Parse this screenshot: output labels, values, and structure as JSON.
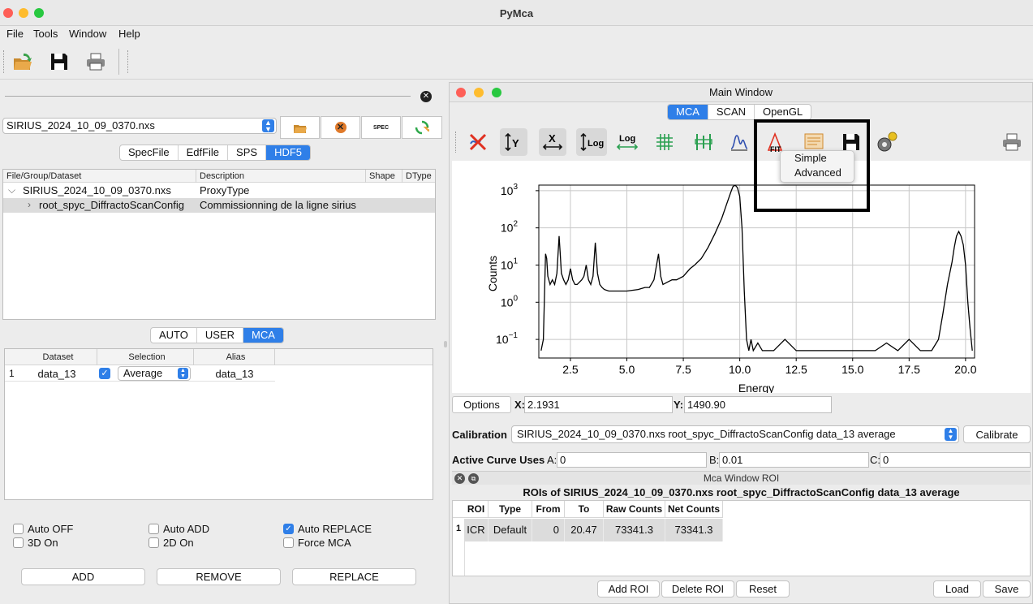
{
  "app": {
    "title": "PyMca"
  },
  "colors": {
    "accent": "#2f7fe8",
    "close": "#fe5f57",
    "minimize": "#febc2e",
    "maximize": "#28c840"
  },
  "menu": [
    "File",
    "Tools",
    "Window",
    "Help"
  ],
  "toolbar_icons": [
    "open-icon",
    "save-icon",
    "print-icon"
  ],
  "left": {
    "file_select": "SIRIUS_2024_10_09_0370.nxs",
    "source_tabs": [
      "SpecFile",
      "EdfFile",
      "SPS",
      "HDF5"
    ],
    "source_active": "HDF5",
    "tree_headers": [
      "File/Group/Dataset",
      "Description",
      "Shape",
      "DType"
    ],
    "tree_rows": [
      {
        "name": "SIRIUS_2024_10_09_0370.nxs",
        "desc": "ProxyType",
        "indent": 0,
        "arrow": "⌵"
      },
      {
        "name": "root_spyc_DiffractoScanConfig",
        "desc": "Commissionning de la ligne sirius",
        "indent": 1,
        "arrow": "›"
      }
    ],
    "mode_tabs": [
      "AUTO",
      "USER",
      "MCA"
    ],
    "mode_active": "MCA",
    "sel_headers": [
      "Dataset",
      "Selection",
      "Alias"
    ],
    "sel_row": {
      "num": "1",
      "dataset": "data_13",
      "selection": "Average",
      "alias": "data_13"
    },
    "options": [
      {
        "label": "Auto OFF",
        "checked": false
      },
      {
        "label": "Auto ADD",
        "checked": false
      },
      {
        "label": "Auto REPLACE",
        "checked": true
      },
      {
        "label": "3D On",
        "checked": false
      },
      {
        "label": "2D On",
        "checked": false
      },
      {
        "label": "Force MCA",
        "checked": false
      }
    ],
    "buttons": [
      "ADD",
      "REMOVE",
      "REPLACE"
    ]
  },
  "main": {
    "title": "Main Window",
    "tabs": [
      "MCA",
      "SCAN",
      "OpenGL"
    ],
    "tab_active": "MCA",
    "popup": [
      "Simple",
      "Advanced"
    ],
    "options_label": "Options",
    "x_label": "X:",
    "x_value": "2.1931",
    "y_label": "Y:",
    "y_value": "1490.90",
    "calibration_label": "Calibration",
    "calibration_value": "SIRIUS_2024_10_09_0370.nxs root_spyc_DiffractoScanConfig data_13 average",
    "calibrate_button": "Calibrate",
    "active_curve_label": "Active Curve Uses",
    "a_label": "A:",
    "a_value": "0",
    "b_label": "B:",
    "b_value": "0.01",
    "c_label": "C:",
    "c_value": "0",
    "roi_panel_title": "Mca Window ROI",
    "roi_title": "ROIs of SIRIUS_2024_10_09_0370.nxs root_spyc_DiffractoScanConfig data_13 average",
    "roi_headers": [
      "ROI",
      "Type",
      "From",
      "To",
      "Raw Counts",
      "Net Counts"
    ],
    "roi_row": {
      "num": "1",
      "roi": "ICR",
      "type": "Default",
      "from": "0",
      "to": "20.47",
      "raw": "73341.3",
      "net": "73341.3"
    },
    "roi_buttons": [
      "Add ROI",
      "Delete ROI",
      "Reset"
    ],
    "file_buttons": [
      "Load",
      "Save"
    ]
  },
  "chart_data": {
    "type": "line",
    "xlabel": "Energy",
    "ylabel": "Counts",
    "xlim": [
      1.1,
      20.4
    ],
    "ylim_log10": [
      -1.5,
      3.15
    ],
    "yscale": "log",
    "grid": true,
    "x_ticks": [
      "2.5",
      "5.0",
      "7.5",
      "10.0",
      "12.5",
      "15.0",
      "17.5",
      "20.0"
    ],
    "y_ticks": [
      {
        "base": "10",
        "exp": "3"
      },
      {
        "base": "10",
        "exp": "2"
      },
      {
        "base": "10",
        "exp": "1"
      },
      {
        "base": "10",
        "exp": "0"
      },
      {
        "base": "10",
        "exp": "−1"
      }
    ],
    "series": [
      {
        "x": [
          1.2,
          1.3,
          1.4,
          1.45,
          1.5,
          1.6,
          1.7,
          1.8,
          1.9,
          2.0,
          2.05,
          2.1,
          2.2,
          2.3,
          2.4,
          2.5,
          2.6,
          2.7,
          2.8,
          3.0,
          3.1,
          3.2,
          3.3,
          3.4,
          3.5,
          3.6,
          3.7,
          3.8,
          3.9,
          4.0,
          4.2,
          4.5,
          5.0,
          5.5,
          5.8,
          6.0,
          6.2,
          6.4,
          6.5,
          6.6,
          6.8,
          7.0,
          7.2,
          7.5,
          7.8,
          8.0,
          8.3,
          8.6,
          8.9,
          9.2,
          9.4,
          9.6,
          9.7,
          9.8,
          9.9,
          10.0,
          10.1,
          10.2,
          10.3,
          10.4,
          10.5,
          10.6,
          10.8,
          11.0,
          11.5,
          12.0,
          12.5,
          13.0,
          14.0,
          15.0,
          16.0,
          16.5,
          17.0,
          17.5,
          18.0,
          18.5,
          18.8,
          19.0,
          19.2,
          19.4,
          19.5,
          19.6,
          19.7,
          19.8,
          19.9,
          20.0,
          20.1,
          20.2,
          20.3
        ],
        "y": [
          0.05,
          0.1,
          20,
          15,
          5,
          3,
          4,
          3,
          6,
          60,
          20,
          6,
          4,
          3,
          4,
          8,
          4,
          3,
          3,
          4,
          5,
          10,
          4,
          3,
          5,
          40,
          6,
          3,
          2.5,
          2.2,
          2,
          2,
          2,
          2.2,
          2.5,
          2.5,
          4,
          20,
          5,
          3,
          3.5,
          4,
          4,
          5,
          8,
          10,
          15,
          30,
          70,
          180,
          400,
          900,
          1300,
          1400,
          1200,
          700,
          100,
          2,
          0.1,
          0.05,
          0.1,
          0.05,
          0.08,
          0.05,
          0.05,
          0.1,
          0.05,
          0.05,
          0.05,
          0.05,
          0.05,
          0.08,
          0.05,
          0.1,
          0.05,
          0.05,
          0.1,
          0.5,
          3,
          12,
          30,
          60,
          80,
          60,
          35,
          10,
          1,
          0.2,
          0.05
        ]
      }
    ]
  }
}
